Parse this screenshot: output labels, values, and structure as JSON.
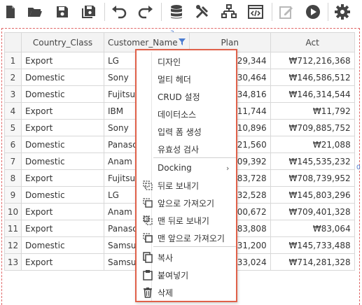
{
  "toolbar": {
    "icons": [
      "new-document-icon",
      "open-folder-icon",
      "save-icon",
      "save-all-icon",
      "undo-icon",
      "redo-icon",
      "database-icon",
      "tools-icon",
      "hierarchy-icon",
      "code-icon",
      "edit-icon",
      "run-icon",
      "settings-icon"
    ]
  },
  "canvas": {
    "marker_top": "3",
    "marker_left": "7",
    "marker_right": "0"
  },
  "grid": {
    "columns": [
      "Country_Class",
      "Customer_Name",
      "Plan",
      "Act"
    ],
    "rows": [
      {
        "no": "1",
        "country": "Export",
        "customer": "LG",
        "plan": "₩629,344",
        "act": "₩712,216,368"
      },
      {
        "no": "2",
        "country": "Domestic",
        "customer": "Sony",
        "plan": "₩330,464",
        "act": "₩146,586,512"
      },
      {
        "no": "3",
        "country": "Domestic",
        "customer": "Fujitsu",
        "plan": "₩334,816",
        "act": "₩146,314,544"
      },
      {
        "no": "4",
        "country": "Export",
        "customer": "IBM",
        "plan": "₩11,744",
        "act": "₩11,792"
      },
      {
        "no": "5",
        "country": "Export",
        "customer": "Sony",
        "plan": "₩610,896",
        "act": "₩709,885,752"
      },
      {
        "no": "6",
        "country": "Domestic",
        "customer": "Panasonic",
        "plan": "₩21,560",
        "act": "₩21,088"
      },
      {
        "no": "7",
        "country": "Domestic",
        "customer": "Anam",
        "plan": "₩609,392",
        "act": "₩145,535,232"
      },
      {
        "no": "8",
        "country": "Export",
        "customer": "Fujitsu",
        "plan": "₩483,728",
        "act": "₩708,739,952"
      },
      {
        "no": "9",
        "country": "Domestic",
        "customer": "LG",
        "plan": "₩032,528",
        "act": "₩145,803,296"
      },
      {
        "no": "10",
        "country": "Export",
        "customer": "Anam",
        "plan": "₩200,672",
        "act": "₩709,401,328"
      },
      {
        "no": "11",
        "country": "Export",
        "customer": "Panasonic",
        "plan": "₩83,808",
        "act": "₩83,064"
      },
      {
        "no": "12",
        "country": "Domestic",
        "customer": "Samsung",
        "plan": "₩331,200",
        "act": "₩145,733,488"
      },
      {
        "no": "13",
        "country": "Export",
        "customer": "Samsung",
        "plan": "₩33,024",
        "act": "₩714,281,328"
      }
    ]
  },
  "context_menu": {
    "items": [
      {
        "label": "디자인",
        "icon": ""
      },
      {
        "label": "멀티 헤더",
        "icon": ""
      },
      {
        "label": "CRUD 설정",
        "icon": ""
      },
      {
        "label": "데이터소스",
        "icon": ""
      },
      {
        "label": "입력 폼 생성",
        "icon": ""
      },
      {
        "label": "유효성 검사",
        "icon": ""
      },
      {
        "label": "Docking",
        "icon": "",
        "submenu": "›"
      },
      {
        "label": "뒤로 보내기",
        "icon": "send-backward-icon"
      },
      {
        "label": "앞으로 가져오기",
        "icon": "bring-forward-icon"
      },
      {
        "label": "맨 뒤로 보내기",
        "icon": "send-to-back-icon"
      },
      {
        "label": "맨 앞으로 가져오기",
        "icon": "bring-to-front-icon"
      },
      {
        "label": "복사",
        "icon": "copy-icon"
      },
      {
        "label": "붙여넣기",
        "icon": "paste-icon"
      },
      {
        "label": "삭제",
        "icon": "delete-icon"
      }
    ]
  },
  "colors": {
    "accent_border": "#e0614a",
    "grid_header_bg": "#f3f3f3",
    "icon_dark": "#444444",
    "icon_disabled": "#b9b9b9"
  }
}
